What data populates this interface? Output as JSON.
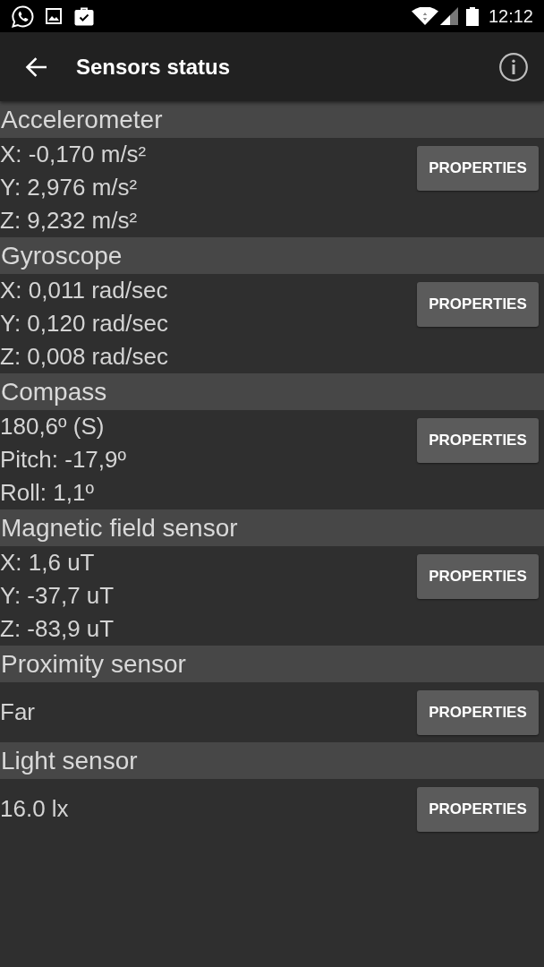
{
  "status_bar": {
    "time": "12:12"
  },
  "app_bar": {
    "title": "Sensors status"
  },
  "sensors": [
    {
      "name": "Accelerometer",
      "readings": [
        "X: -0,170 m/s²",
        "Y: 2,976 m/s²",
        "Z: 9,232 m/s²"
      ],
      "button": "PROPERTIES"
    },
    {
      "name": "Gyroscope",
      "readings": [
        "X: 0,011 rad/sec",
        "Y: 0,120 rad/sec",
        "Z: 0,008 rad/sec"
      ],
      "button": "PROPERTIES"
    },
    {
      "name": "Compass",
      "readings": [
        "180,6º (S)",
        "Pitch: -17,9º",
        "Roll: 1,1º"
      ],
      "button": "PROPERTIES"
    },
    {
      "name": "Magnetic field sensor",
      "readings": [
        "X: 1,6 uT",
        "Y: -37,7 uT",
        "Z: -83,9 uT"
      ],
      "button": "PROPERTIES"
    },
    {
      "name": "Proximity sensor",
      "readings": [
        "Far"
      ],
      "button": "PROPERTIES"
    },
    {
      "name": "Light sensor",
      "readings": [
        "16.0 lx"
      ],
      "button": "PROPERTIES"
    }
  ]
}
